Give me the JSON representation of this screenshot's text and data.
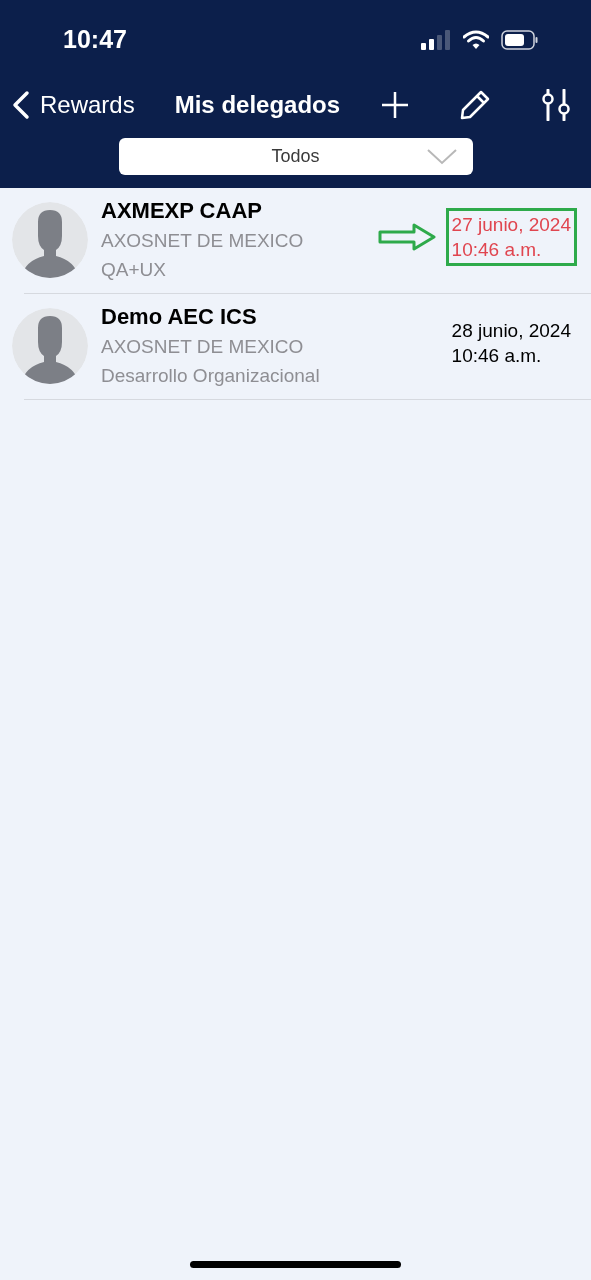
{
  "status_bar": {
    "time": "10:47"
  },
  "nav": {
    "back_label": "Rewards",
    "title": "Mis delegados"
  },
  "filter": {
    "value": "Todos"
  },
  "delegates": [
    {
      "name": "AXMEXP CAAP",
      "company": "AXOSNET DE MEXICO",
      "department": "QA+UX",
      "date": "27 junio, 2024",
      "time": "10:46 a.m.",
      "highlighted": true
    },
    {
      "name": "Demo AEC ICS",
      "company": "AXOSNET DE MEXICO",
      "department": "Desarrollo Organizacional",
      "date": "28 junio, 2024",
      "time": "10:46 a.m.",
      "highlighted": false
    }
  ]
}
